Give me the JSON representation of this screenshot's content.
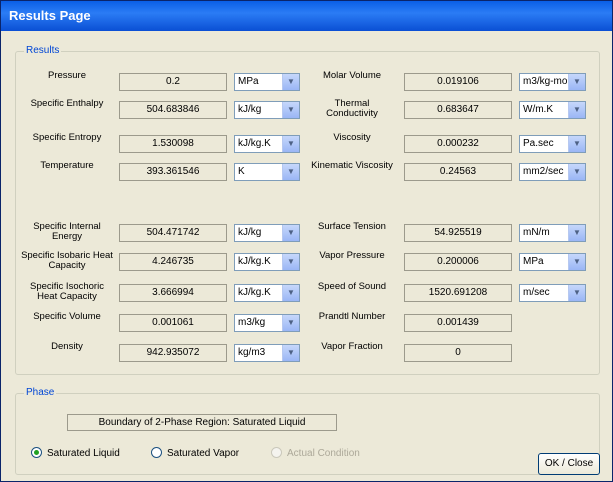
{
  "window": {
    "title": "Results Page"
  },
  "results": {
    "legend": "Results",
    "left": [
      {
        "label": "Pressure",
        "value": "0.2",
        "unit": "MPa"
      },
      {
        "label": "Specific Enthalpy",
        "value": "504.683846",
        "unit": "kJ/kg"
      },
      {
        "label": "Specific Entropy",
        "value": "1.530098",
        "unit": "kJ/kg.K"
      },
      {
        "label": "Temperature",
        "value": "393.361546",
        "unit": "K"
      },
      {
        "label": "Specific Internal Energy",
        "value": "504.471742",
        "unit": "kJ/kg"
      },
      {
        "label": "Specific Isobaric Heat Capacity",
        "value": "4.246735",
        "unit": "kJ/kg.K"
      },
      {
        "label": "Specific Isochoric Heat Capacity",
        "value": "3.666994",
        "unit": "kJ/kg.K"
      },
      {
        "label": "Specific Volume",
        "value": "0.001061",
        "unit": "m3/kg"
      },
      {
        "label": "Density",
        "value": "942.935072",
        "unit": "kg/m3"
      }
    ],
    "right": [
      {
        "label": "Molar Volume",
        "value": "0.019106",
        "unit": "m3/kg-mol"
      },
      {
        "label": "Thermal Conductivity",
        "value": "0.683647",
        "unit": "W/m.K"
      },
      {
        "label": "Viscosity",
        "value": "0.000232",
        "unit": "Pa.sec"
      },
      {
        "label": "Kinematic Viscosity",
        "value": "0.24563",
        "unit": "mm2/sec"
      },
      {
        "label": "Surface Tension",
        "value": "54.925519",
        "unit": "mN/m"
      },
      {
        "label": "Vapor Pressure",
        "value": "0.200006",
        "unit": "MPa"
      },
      {
        "label": "Speed of Sound",
        "value": "1520.691208",
        "unit": "m/sec"
      },
      {
        "label": "Prandtl Number",
        "value": "0.001439",
        "unit": ""
      },
      {
        "label": "Vapor Fraction",
        "value": "0",
        "unit": ""
      }
    ]
  },
  "phase": {
    "legend": "Phase",
    "status_text": "Boundary of 2-Phase Region: Saturated Liquid",
    "options": [
      {
        "label": "Saturated Liquid",
        "checked": true,
        "enabled": true
      },
      {
        "label": "Saturated Vapor",
        "checked": false,
        "enabled": true
      },
      {
        "label": "Actual Condition",
        "checked": false,
        "enabled": false
      }
    ]
  },
  "buttons": {
    "ok_close": "OK / Close"
  },
  "icons": {
    "dropdown": "chevron-down-icon",
    "radio": "radio-icon"
  },
  "colors": {
    "title_bar": "#0a5fe6",
    "legend_text": "#0046d5",
    "window_bg": "#ece9d8"
  }
}
